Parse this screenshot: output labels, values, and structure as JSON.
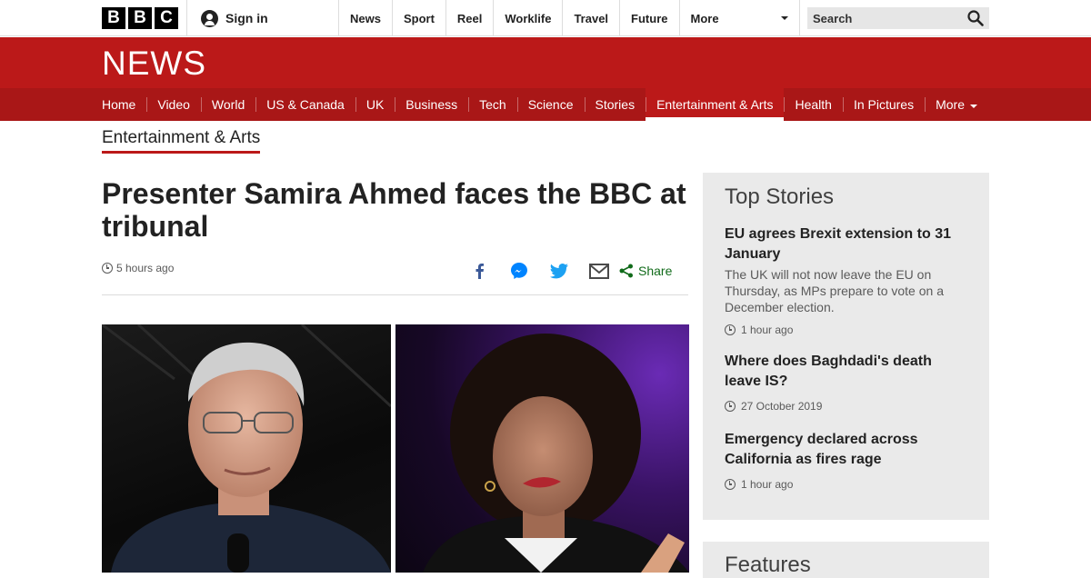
{
  "topbar": {
    "logo_letters": [
      "B",
      "B",
      "C"
    ],
    "signin_label": "Sign in",
    "nav": [
      "News",
      "Sport",
      "Reel",
      "Worklife",
      "Travel",
      "Future"
    ],
    "more_label": "More",
    "search_placeholder": "Search"
  },
  "banner": {
    "title": "NEWS",
    "sections": [
      {
        "label": "Home",
        "active": false
      },
      {
        "label": "Video",
        "active": false
      },
      {
        "label": "World",
        "active": false
      },
      {
        "label": "US & Canada",
        "active": false
      },
      {
        "label": "UK",
        "active": false
      },
      {
        "label": "Business",
        "active": false
      },
      {
        "label": "Tech",
        "active": false
      },
      {
        "label": "Science",
        "active": false
      },
      {
        "label": "Stories",
        "active": false
      },
      {
        "label": "Entertainment & Arts",
        "active": true
      },
      {
        "label": "Health",
        "active": false
      },
      {
        "label": "In Pictures",
        "active": false
      }
    ],
    "more_label": "More"
  },
  "article": {
    "section": "Entertainment & Arts",
    "headline": "Presenter Samira Ahmed faces the BBC at tribunal",
    "timestamp": "5 hours ago",
    "share_label": "Share",
    "share_icons": [
      "facebook-icon",
      "messenger-icon",
      "twitter-icon",
      "email-icon"
    ]
  },
  "sidebar": {
    "top_stories_title": "Top Stories",
    "stories": [
      {
        "title": "EU agrees Brexit extension to 31 January",
        "summary": "The UK will not now leave the EU on Thursday, as MPs prepare to vote on a December election.",
        "time": "1 hour ago"
      },
      {
        "title": "Where does Baghdadi's death leave IS?",
        "summary": "",
        "time": "27 October 2019"
      },
      {
        "title": "Emergency declared across California as fires rage",
        "summary": "",
        "time": "1 hour ago"
      }
    ],
    "features_title": "Features"
  },
  "colors": {
    "brand_red": "#bb1919",
    "subnav_red": "#a91717",
    "share_green": "#116b1a",
    "sidebar_bg": "#eaeaea"
  }
}
